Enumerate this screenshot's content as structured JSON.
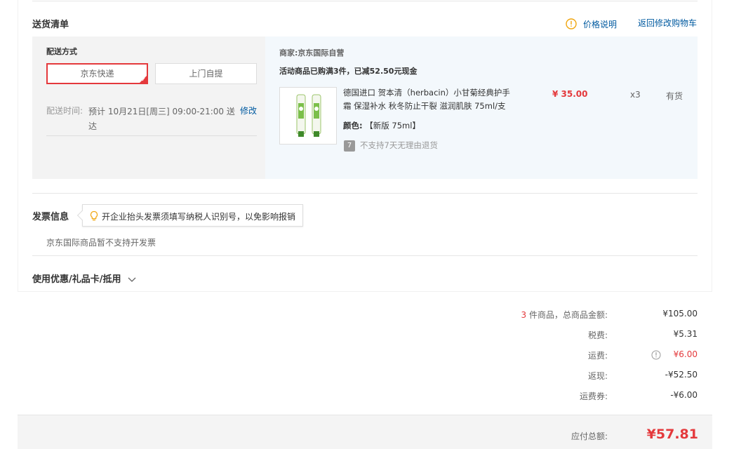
{
  "shipping_list": {
    "title": "送货清单",
    "price_note_label": "价格说明",
    "back_to_cart_label": "返回修改购物车"
  },
  "delivery": {
    "section_label": "配送方式",
    "options": [
      "京东快递",
      "上门自提"
    ],
    "selected_option": "京东快递",
    "time_label": "配送时间:",
    "time_value": "预计 10月21日[周三] 09:00-21:00 送达",
    "time_value_line1": "预计 10月21日[周三] 09:00-21:00 送",
    "time_value_line2": "达",
    "modify_label": "修改"
  },
  "seller": {
    "label": "商家:",
    "name": "京东国际自营",
    "promo": "活动商品已购满3件，已减52.50元现金"
  },
  "product": {
    "name_line1": "德国进口 贺本清（herbacin）小甘菊经典护手",
    "name_line2": "霜 保湿补水 秋冬防止干裂 滋润肌肤 75ml/支",
    "color_label": "颜色:",
    "color_value": "【新版 75ml】",
    "return_badge": "7",
    "return_note": "不支持7天无理由退货",
    "price": "¥ 35.00",
    "quantity": "x3",
    "stock": "有货"
  },
  "invoice": {
    "title": "发票信息",
    "tip": "开企业抬头发票须填写纳税人识别号，以免影响报销",
    "note": "京东国际商品暂不支持开发票"
  },
  "coupons": {
    "label": "使用优惠/礼品卡/抵用"
  },
  "summary": {
    "item_count": "3",
    "items_label": "件商品，总商品金额:",
    "items_value": "¥105.00",
    "tax_label": "税费:",
    "tax_value": "¥5.31",
    "shipping_label": "运费:",
    "shipping_value": "¥6.00",
    "cashback_label": "返现:",
    "cashback_value": "-¥52.50",
    "ship_coupon_label": "运费券:",
    "ship_coupon_value": "-¥6.00"
  },
  "footer": {
    "total_label": "应付总额:",
    "total_value": "¥57.81"
  },
  "colors": {
    "accent": "#e4393c",
    "link": "#005aa0",
    "warning": "#f0a50e",
    "shipping_bg": "#f3f3f3",
    "item_bg": "#f3f8fc"
  }
}
